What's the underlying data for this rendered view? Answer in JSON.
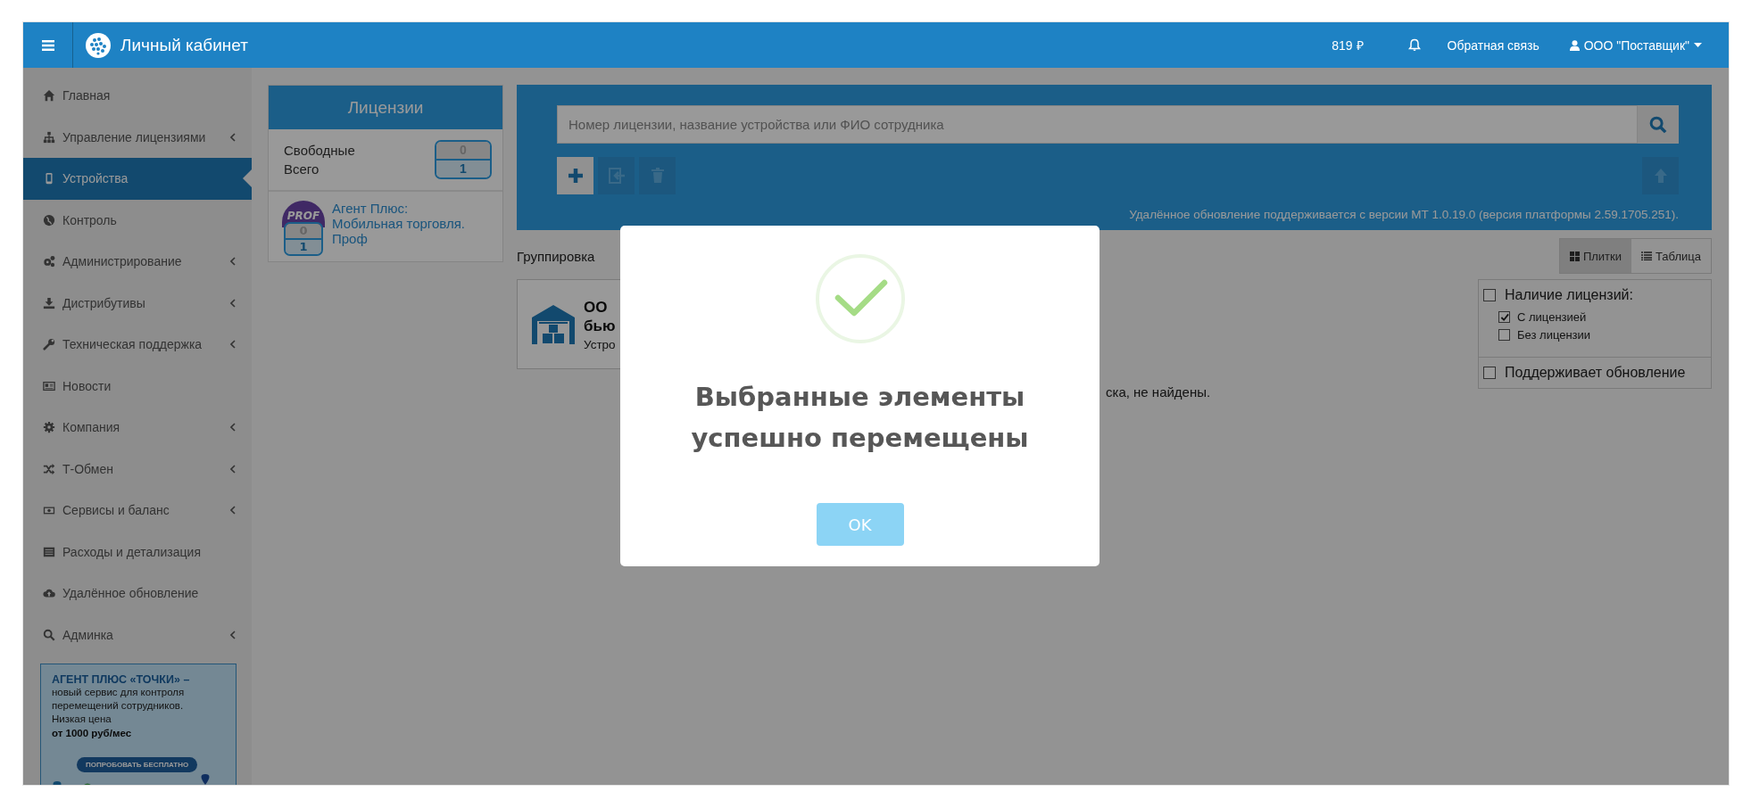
{
  "topbar": {
    "title": "Личный кабинет",
    "balance": "819 ₽",
    "feedback": "Обратная связь",
    "account": "ООО \"Поставщик\""
  },
  "sidebar": {
    "items": [
      {
        "label": "Главная",
        "selected": false,
        "expandable": false
      },
      {
        "label": "Управление лицензиями",
        "selected": false,
        "expandable": true
      },
      {
        "label": "Устройства",
        "selected": true,
        "expandable": false
      },
      {
        "label": "Контроль",
        "selected": false,
        "expandable": false
      },
      {
        "label": "Администрирование",
        "selected": false,
        "expandable": true
      },
      {
        "label": "Дистрибутивы",
        "selected": false,
        "expandable": true
      },
      {
        "label": "Техническая поддержка",
        "selected": false,
        "expandable": true
      },
      {
        "label": "Новости",
        "selected": false,
        "expandable": false
      },
      {
        "label": "Компания",
        "selected": false,
        "expandable": true
      },
      {
        "label": "Т-Обмен",
        "selected": false,
        "expandable": true
      },
      {
        "label": "Сервисы и баланс",
        "selected": false,
        "expandable": true
      },
      {
        "label": "Расходы и детализация",
        "selected": false,
        "expandable": false
      },
      {
        "label": "Удалённое обновление",
        "selected": false,
        "expandable": false
      },
      {
        "label": "Админка",
        "selected": false,
        "expandable": true
      }
    ],
    "promo": {
      "title": "АГЕНТ ПЛЮС «ТОЧКИ» –",
      "text": "новый сервис для контроля перемещений сотрудников. Низкая цена",
      "price": "от 1000 руб/мес",
      "button": "ПОПРОБОВАТЬ БЕСПЛАТНО"
    }
  },
  "licenses": {
    "title": "Лицензии",
    "summary": {
      "labels": [
        "Свободные",
        "Всего"
      ],
      "free": "0",
      "total": "1"
    },
    "products": [
      {
        "badge": "PROF",
        "name": "Агент Плюс: Мобильная торговля. Проф",
        "free": "0",
        "total": "1"
      }
    ]
  },
  "search": {
    "placeholder": "Номер лицензии, название устройства или ФИО сотрудника"
  },
  "toolbar": [
    {
      "kind": "add",
      "disabled": false
    },
    {
      "kind": "move",
      "disabled": true
    },
    {
      "kind": "delete",
      "disabled": true
    }
  ],
  "upload_button": {
    "disabled": true
  },
  "version_note": "Удалённое обновление поддерживается с версии МТ 1.0.19.0 (версия платформы 2.59.1705.251).",
  "grouping_label": "Группировка",
  "view_toggle": [
    {
      "label": "Плитки",
      "selected": true
    },
    {
      "label": "Таблица",
      "selected": false
    }
  ],
  "filters": [
    {
      "label": "Наличие лицензий:",
      "checked": false,
      "children": [
        {
          "label": "С лицензией",
          "checked": true
        },
        {
          "label": "Без лицензии",
          "checked": false
        }
      ]
    },
    {
      "label": "Поддерживает обновление",
      "checked": false
    }
  ],
  "device_card": {
    "title_lines": [
      "ОО",
      "бью"
    ],
    "subtitle": "Устро"
  },
  "empty_message": "ска, не найдены.",
  "modal": {
    "message": "Выбранные элементы успешно перемещены",
    "button": "OK"
  }
}
